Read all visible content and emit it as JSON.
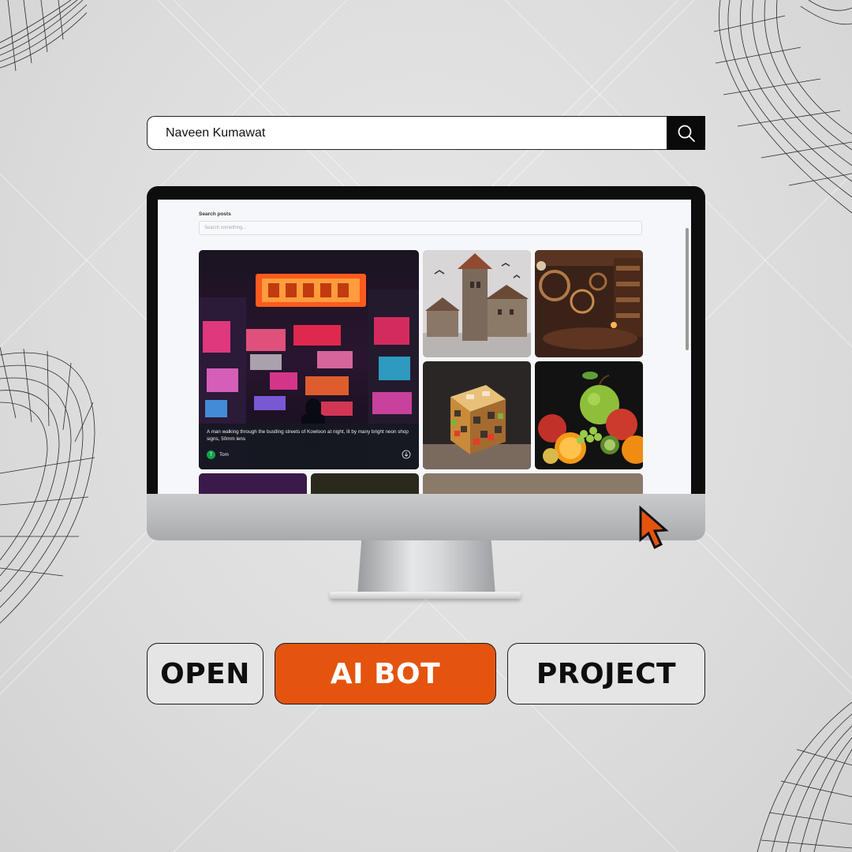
{
  "top_search": {
    "value": "Naveen Kumawat"
  },
  "app": {
    "search_label": "Search posts",
    "search_placeholder": "Search something...",
    "featured_post": {
      "prompt": "A man walking through the bustling streets of Kowloon at night, lit by many bright neon shop signs, 50mm lens",
      "author": "Tom",
      "author_initial": "T"
    }
  },
  "buttons": {
    "open": "OPEN",
    "ai_bot": "AI BOT",
    "project": "PROJECT"
  },
  "colors": {
    "accent": "#e4540f",
    "avatar": "#11a34a",
    "dark": "#0a0a0a"
  }
}
